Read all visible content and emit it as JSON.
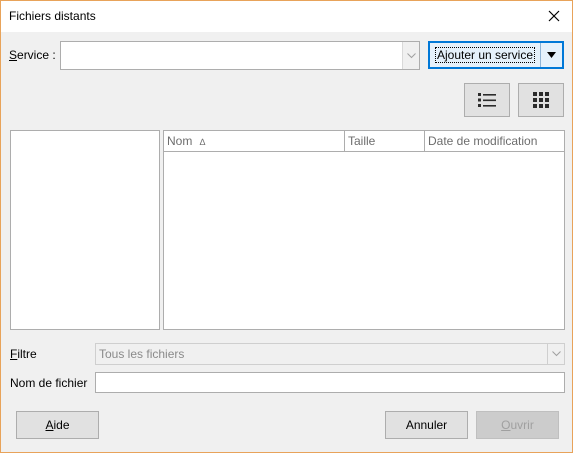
{
  "window": {
    "title": "Fichiers distants"
  },
  "service": {
    "label_accel": "S",
    "label_rest": "ervice :",
    "value": "",
    "add_button": "Ajouter un service"
  },
  "view_icons": {
    "list": "list-view-icon",
    "grid": "grid-view-icon"
  },
  "file_list": {
    "columns": [
      "Nom",
      "Taille",
      "Date de modification"
    ],
    "sort_column": "Nom",
    "sort_indicator": "∆",
    "rows": []
  },
  "filter": {
    "label_accel": "F",
    "label_rest": "iltre",
    "value": "Tous les fichiers"
  },
  "filename": {
    "label": "Nom de fichier",
    "value": ""
  },
  "buttons": {
    "help_accel": "A",
    "help_rest": "ide",
    "cancel": "Annuler",
    "open_accel": "O",
    "open_rest": "uvrir"
  },
  "colors": {
    "accent": "#0078d7",
    "window_border": "#e8a35a"
  }
}
